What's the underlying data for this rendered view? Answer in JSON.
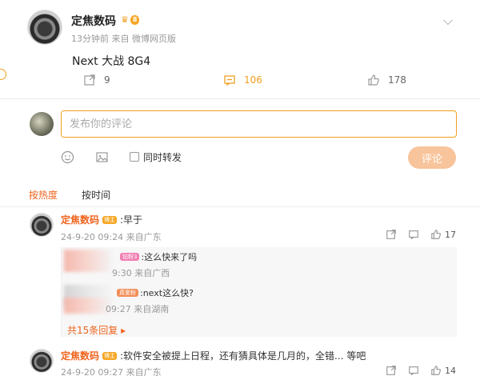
{
  "post": {
    "author": "定焦数码",
    "vip_level": "8",
    "meta": "13分钟前 来自 微博网页版",
    "text": "Next 大战 8G4",
    "reposts": "9",
    "comments": "106",
    "likes": "178"
  },
  "composer": {
    "placeholder": "发布你的评论",
    "forward_label": "同时转发",
    "submit_label": "评论"
  },
  "sort": {
    "hot_label": "按热度",
    "time_label": "按时间"
  },
  "comments": [
    {
      "author": "定焦数码",
      "badge": "博主",
      "text": ":早于",
      "meta": "24-9-20 09:24 来自广东",
      "likes": "17",
      "replies": [
        {
          "badge": "钻粉3",
          "text": ":这么快来了吗",
          "meta": "9:30 来自广西"
        },
        {
          "badge": "真爱粉",
          "text": ":next这么快?",
          "meta": "09:27 来自湖南"
        }
      ],
      "more_replies": "共15条回复"
    },
    {
      "author": "定焦数码",
      "badge": "博主",
      "text": ":软件安全被提上日程，还有猜具体是几月的，全错... 等吧",
      "meta": "24-9-20 09:27 来自广东",
      "likes": "14"
    }
  ],
  "colors": {
    "accent": "#f0641e",
    "brand_orange": "#f0a020",
    "submit_disabled": "#f8c49b"
  },
  "icons": {
    "repost": "repost-icon",
    "comment": "comment-icon",
    "like": "like-icon",
    "emoji": "emoji-icon",
    "image": "image-icon",
    "more": "chevron-down-icon"
  }
}
